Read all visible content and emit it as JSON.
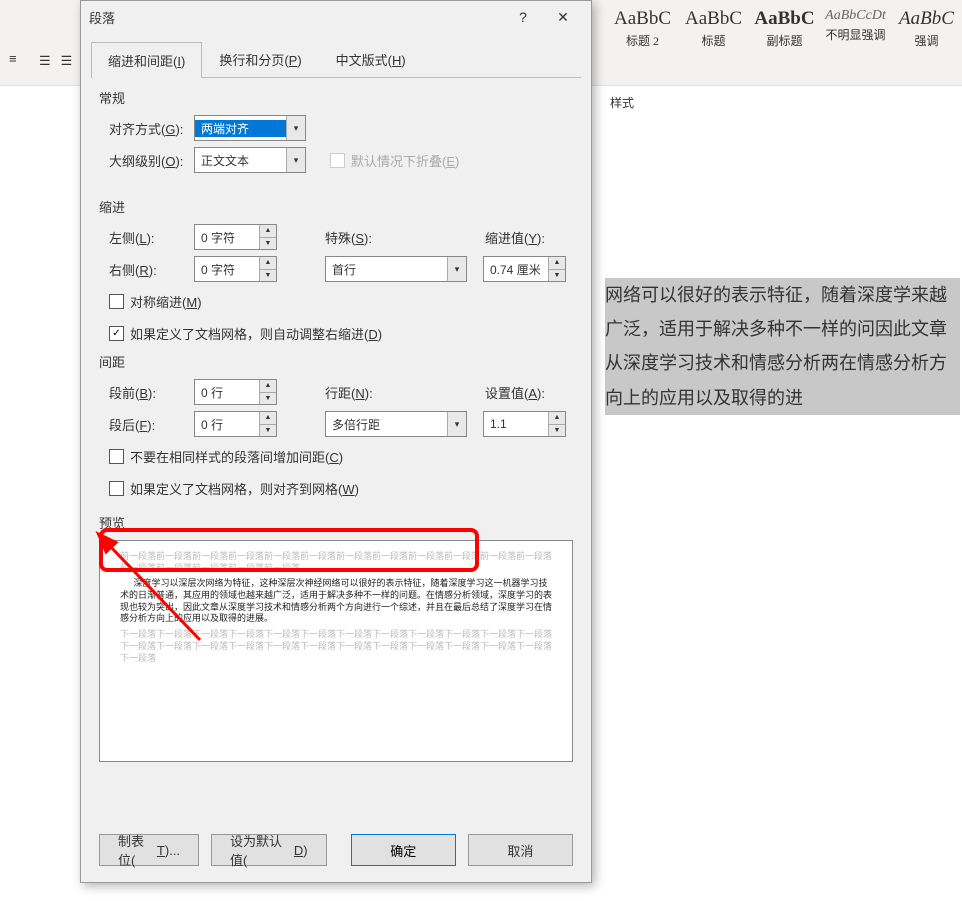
{
  "ribbon": {
    "styles": [
      {
        "preview": "AaBbC",
        "label": "标题 2",
        "weight": "normal"
      },
      {
        "preview": "AaBbC",
        "label": "标题",
        "weight": "normal"
      },
      {
        "preview": "AaBbC",
        "label": "副标题",
        "weight": "bold"
      },
      {
        "preview": "AaBbCcDt",
        "label": "不明显强调",
        "style": "italic"
      },
      {
        "preview": "AaBbC",
        "label": "强调",
        "style": "italic"
      }
    ],
    "section_label": "样式"
  },
  "document_text": "网络可以很好的表示特征，随着深度学来越广泛，适用于解决多种不一样的问因此文章从深度学习技术和情感分析两在情感分析方向上的应用以及取得的进",
  "dialog": {
    "title": "段落",
    "help": "?",
    "close": "✕",
    "tabs": [
      "缩进和间距(I)",
      "换行和分页(P)",
      "中文版式(H)"
    ],
    "active_tab": 0,
    "general": {
      "heading": "常规",
      "alignment_label": "对齐方式(G):",
      "alignment_value": "两端对齐",
      "outline_label": "大纲级别(O):",
      "outline_value": "正文文本",
      "collapse_label": "默认情况下折叠(E)"
    },
    "indent": {
      "heading": "缩进",
      "left_label": "左侧(L):",
      "left_value": "0 字符",
      "right_label": "右侧(R):",
      "right_value": "0 字符",
      "special_label": "特殊(S):",
      "special_value": "首行",
      "by_label": "缩进值(Y):",
      "by_value": "0.74 厘米",
      "mirror_label": "对称缩进(M)",
      "grid_label": "如果定义了文档网格，则自动调整右缩进(D)"
    },
    "spacing": {
      "heading": "间距",
      "before_label": "段前(B):",
      "before_value": "0 行",
      "after_label": "段后(F):",
      "after_value": "0 行",
      "line_label": "行距(N):",
      "line_value": "多倍行距",
      "at_label": "设置值(A):",
      "at_value": "1.1",
      "no_space_label": "不要在相同样式的段落间增加间距(C)",
      "grid_align_label": "如果定义了文档网格，则对齐到网格(W)"
    },
    "preview": {
      "heading": "预览",
      "placeholder_before": "前一段落前一段落前一段落前一段落前一段落前一段落前一段落前一段落前一段落前一段落前一段落前一段落前一段落前一段落前一段落前一段落前一段落",
      "main": "深度学习以深层次网络为特征，这种深层次神经网络可以很好的表示特征，随着深度学习这一机器学习技术的日渐普通，其应用的领域也越来越广泛，适用于解决多种不一样的问题。在情感分析领域，深度学习的表现也较为突出，因此文章从深度学习技术和情感分析两个方向进行一个综述，并且在最后总结了深度学习在情感分析方向上的应用以及取得的进展。",
      "placeholder_after": "下一段落下一段落下一段落下一段落下一段落下一段落下一段落下一段落下一段落下一段落下一段落下一段落下一段落下一段落下一段落下一段落下一段落下一段落下一段落下一段落下一段落下一段落下一段落下一段落下一段落"
    },
    "actions": {
      "tabs": "制表位(T)...",
      "default": "设为默认值(D)",
      "ok": "确定",
      "cancel": "取消"
    }
  }
}
